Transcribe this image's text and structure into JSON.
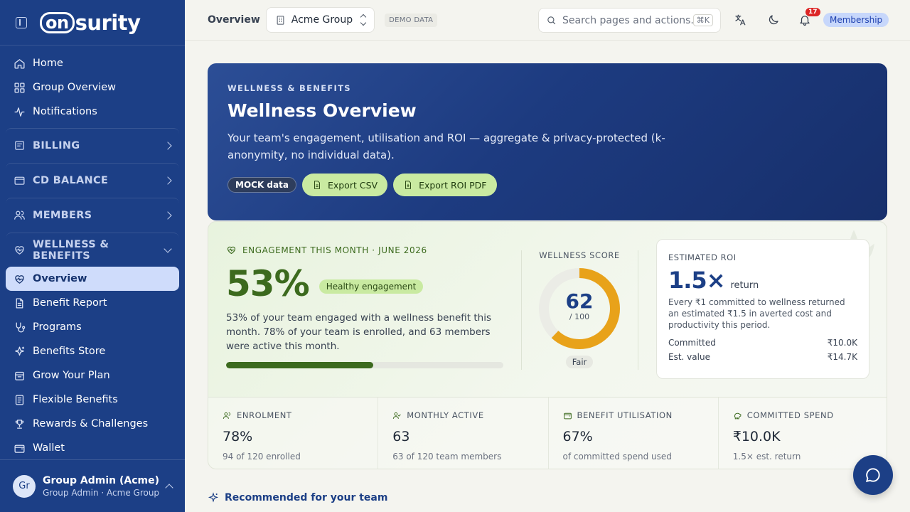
{
  "brand": {
    "logo_prefix": "on",
    "logo_suffix": "surity"
  },
  "sidebar": {
    "top_items": [
      {
        "label": "Home",
        "icon": "home-icon"
      },
      {
        "label": "Group Overview",
        "icon": "grid-icon"
      },
      {
        "label": "Notifications",
        "icon": "activity-icon"
      }
    ],
    "sections": [
      {
        "label": "BILLING",
        "icon": "receipt-icon"
      },
      {
        "label": "CD BALANCE",
        "icon": "wallet-icon"
      },
      {
        "label": "MEMBERS",
        "icon": "users-icon"
      },
      {
        "label": "WELLNESS & BENEFITS",
        "icon": "heart-pulse-icon"
      }
    ],
    "wellness_items": [
      {
        "label": "Overview",
        "icon": "heart-pulse-icon",
        "active": true
      },
      {
        "label": "Benefit Report",
        "icon": "file-icon"
      },
      {
        "label": "Programs",
        "icon": "stethoscope-icon"
      },
      {
        "label": "Benefits Store",
        "icon": "sparkle-icon"
      },
      {
        "label": "Grow Your Plan",
        "icon": "calendar-icon"
      },
      {
        "label": "Flexible Benefits",
        "icon": "doc-list-icon"
      },
      {
        "label": "Rewards & Challenges",
        "icon": "trophy-icon"
      },
      {
        "label": "Wallet",
        "icon": "wallet-icon"
      }
    ],
    "user": {
      "initials": "Gr",
      "name": "Group Admin (Acme)",
      "subtitle": "Group Admin · Acme Group"
    }
  },
  "topbar": {
    "breadcrumb": "Overview",
    "group": "Acme Group",
    "demo_badge": "DEMO DATA",
    "search_placeholder": "Search pages and actions...",
    "search_shortcut": "⌘K",
    "notification_count": "17",
    "membership": "Membership"
  },
  "hero": {
    "eyebrow": "WELLNESS & BENEFITS",
    "title": "Wellness Overview",
    "description": "Your team's engagement, utilisation and ROI — aggregate & privacy-protected (k-anonymity, no individual data).",
    "mock_label": "MOCK data",
    "export_csv": "Export CSV",
    "export_pdf": "Export ROI PDF"
  },
  "engagement": {
    "eyebrow": "ENGAGEMENT THIS MONTH · JUNE 2026",
    "value": "53%",
    "value_fraction": 0.53,
    "badge": "Healthy engagement",
    "description": "53% of your team engaged with a wellness benefit this month. 78% of your team is enrolled, and 63 members were active this month."
  },
  "wellness_score": {
    "label": "WELLNESS SCORE",
    "value": "62",
    "max": "/ 100",
    "fraction": 0.62,
    "rating": "Fair"
  },
  "roi": {
    "label": "ESTIMATED ROI",
    "value": "1.5×",
    "unit": "return",
    "description": "Every ₹1 committed to wellness returned an estimated ₹1.5 in averted cost and productivity this period.",
    "committed_label": "Committed",
    "committed_value": "₹10.0K",
    "est_label": "Est. value",
    "est_value": "₹14.7K"
  },
  "stats": [
    {
      "label": "ENROLMENT",
      "value": "78%",
      "sub": "94 of 120 enrolled",
      "icon": "users-icon"
    },
    {
      "label": "MONTHLY ACTIVE",
      "value": "63",
      "sub": "63 of 120 team members",
      "icon": "user-check-icon"
    },
    {
      "label": "BENEFIT UTILISATION",
      "value": "67%",
      "sub": "of committed spend used",
      "icon": "wallet-icon"
    },
    {
      "label": "COMMITTED SPEND",
      "value": "₹10.0K",
      "sub": "1.5× est. return",
      "icon": "piggy-bank-icon"
    }
  ],
  "recommended": {
    "title": "Recommended for your team"
  },
  "colors": {
    "sidebar": "#1c3f86",
    "accent_green": "#3c6a1e",
    "donut": "#e8a21a",
    "active_nav": "#cfdcfb"
  }
}
